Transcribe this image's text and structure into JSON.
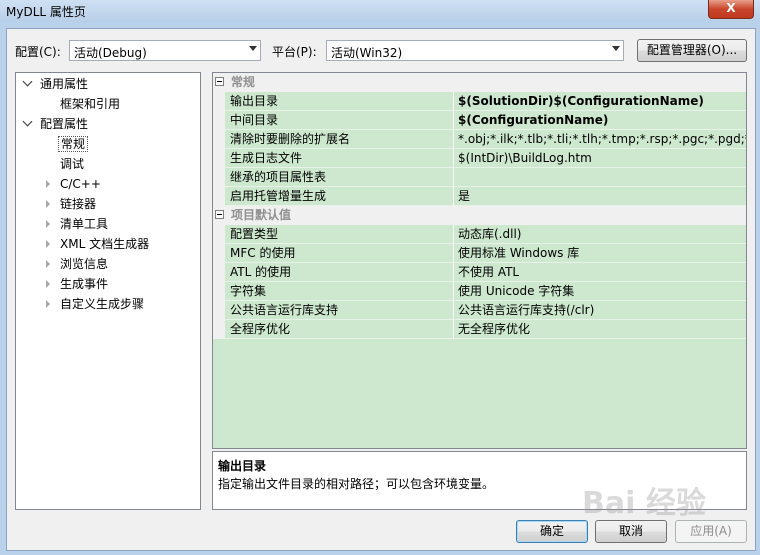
{
  "window": {
    "title": "MyDLL 属性页",
    "close_label": "X"
  },
  "toolbar": {
    "config_label": "配置(C):",
    "config_value": "活动(Debug)",
    "platform_label": "平台(P):",
    "platform_value": "活动(Win32)",
    "config_manager_label": "配置管理器(O)..."
  },
  "tree": {
    "items": [
      {
        "label": "通用属性",
        "expanded": true
      },
      {
        "label": "框架和引用"
      },
      {
        "label": "配置属性",
        "expanded": true
      },
      {
        "label": "常规",
        "selected": true
      },
      {
        "label": "调试"
      },
      {
        "label": "C/C++"
      },
      {
        "label": "链接器"
      },
      {
        "label": "清单工具"
      },
      {
        "label": "XML 文档生成器"
      },
      {
        "label": "浏览信息"
      },
      {
        "label": "生成事件"
      },
      {
        "label": "自定义生成步骤"
      }
    ]
  },
  "grid": {
    "categories": [
      {
        "name": "常规",
        "props": [
          {
            "name": "输出目录",
            "value": "$(SolutionDir)$(ConfigurationName)",
            "bold": true
          },
          {
            "name": "中间目录",
            "value": "$(ConfigurationName)",
            "bold": true
          },
          {
            "name": "清除时要删除的扩展名",
            "value": "*.obj;*.ilk;*.tlb;*.tli;*.tlh;*.tmp;*.rsp;*.pgc;*.pgd;*.meta;$"
          },
          {
            "name": "生成日志文件",
            "value": "$(IntDir)\\BuildLog.htm"
          },
          {
            "name": "继承的项目属性表",
            "value": ""
          },
          {
            "name": "启用托管增量生成",
            "value": "是"
          }
        ]
      },
      {
        "name": "项目默认值",
        "props": [
          {
            "name": "配置类型",
            "value": "动态库(.dll)"
          },
          {
            "name": "MFC 的使用",
            "value": "使用标准 Windows 库"
          },
          {
            "name": "ATL 的使用",
            "value": "不使用 ATL"
          },
          {
            "name": "字符集",
            "value": "使用 Unicode 字符集"
          },
          {
            "name": "公共语言运行库支持",
            "value": "公共语言运行库支持(/clr)"
          },
          {
            "name": "全程序优化",
            "value": "无全程序优化"
          }
        ]
      }
    ]
  },
  "description": {
    "title": "输出目录",
    "text": "指定输出文件目录的相对路径；可以包含环境变量。"
  },
  "buttons": {
    "ok": "确定",
    "cancel": "取消",
    "apply": "应用(A)"
  },
  "watermark": "Bai 经验",
  "colors": {
    "prop_bg": "#cde8ce",
    "accent": "#3c7fb1"
  }
}
